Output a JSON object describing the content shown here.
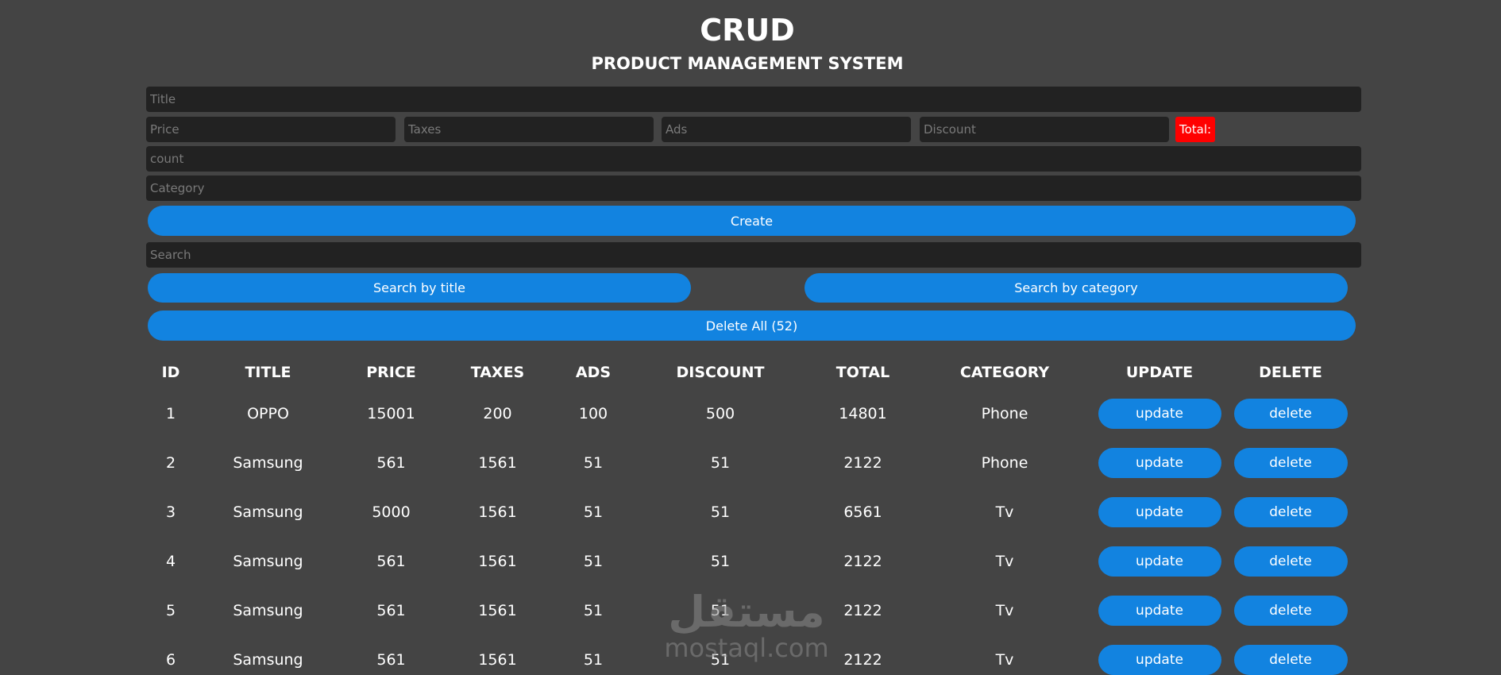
{
  "header": {
    "title": "CRUD",
    "subtitle": "PRODUCT MANAGEMENT SYSTEM"
  },
  "form": {
    "title_placeholder": "Title",
    "price_placeholder": "Price",
    "taxes_placeholder": "Taxes",
    "ads_placeholder": "Ads",
    "discount_placeholder": "Discount",
    "total_label": "Total:",
    "count_placeholder": "count",
    "category_placeholder": "Category",
    "create_label": "Create",
    "search_placeholder": "Search",
    "search_by_title_label": "Search by title",
    "search_by_category_label": "Search by category",
    "delete_all_label": "Delete All (52)"
  },
  "colors": {
    "background": "#444444",
    "input_background": "#222222",
    "button_blue": "#1283e0",
    "total_red": "#ff0000"
  },
  "table": {
    "headers": {
      "id": "ID",
      "title": "TITLE",
      "price": "PRICE",
      "taxes": "TAXES",
      "ads": "ADS",
      "discount": "DISCOUNT",
      "total": "TOTAL",
      "category": "CATEGORY",
      "update": "UPDATE",
      "delete": "DELETE"
    },
    "update_label": "update",
    "delete_label": "delete",
    "rows": [
      {
        "id": "1",
        "title": "OPPO",
        "price": "15001",
        "taxes": "200",
        "ads": "100",
        "discount": "500",
        "total": "14801",
        "category": "Phone"
      },
      {
        "id": "2",
        "title": "Samsung",
        "price": "561",
        "taxes": "1561",
        "ads": "51",
        "discount": "51",
        "total": "2122",
        "category": "Phone"
      },
      {
        "id": "3",
        "title": "Samsung",
        "price": "5000",
        "taxes": "1561",
        "ads": "51",
        "discount": "51",
        "total": "6561",
        "category": "Tv"
      },
      {
        "id": "4",
        "title": "Samsung",
        "price": "561",
        "taxes": "1561",
        "ads": "51",
        "discount": "51",
        "total": "2122",
        "category": "Tv"
      },
      {
        "id": "5",
        "title": "Samsung",
        "price": "561",
        "taxes": "1561",
        "ads": "51",
        "discount": "51",
        "total": "2122",
        "category": "Tv"
      },
      {
        "id": "6",
        "title": "Samsung",
        "price": "561",
        "taxes": "1561",
        "ads": "51",
        "discount": "51",
        "total": "2122",
        "category": "Tv"
      }
    ]
  },
  "watermark": {
    "arabic": "مستقل",
    "text": "mostaql.com"
  }
}
